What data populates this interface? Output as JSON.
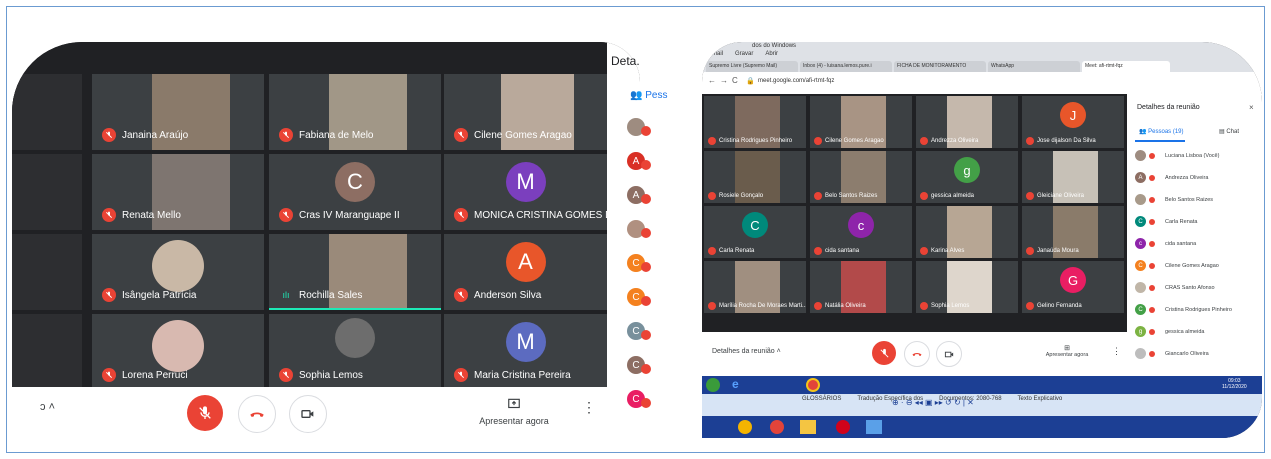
{
  "left": {
    "sidebar": {
      "title": "Deta.",
      "people_tab": "Pess"
    },
    "participants": [
      {
        "name": "Janaina Araújo",
        "type": "photo",
        "color": "#8a7a6a"
      },
      {
        "name": "Fabiana de Melo",
        "type": "photo",
        "color": "#a19787"
      },
      {
        "name": "Cilene Gomes Aragao",
        "type": "photo",
        "color": "#b9a99b"
      },
      {
        "name": "Renata Mello",
        "type": "photo",
        "color": "#7e7570"
      },
      {
        "name": "Cras IV Maranguape II",
        "type": "avatar",
        "initial": "C",
        "color": "#8d6e63"
      },
      {
        "name": "MONICA CRISTINA GOMES DE ...",
        "type": "avatar",
        "initial": "M",
        "color": "#7b3fbe"
      },
      {
        "name": "Isângela Patrícia",
        "type": "photo",
        "color": "#c9b8a6"
      },
      {
        "name": "Rochilla Sales",
        "type": "photo",
        "color": "#9a8a7a"
      },
      {
        "name": "Anderson Silva",
        "type": "avatar",
        "initial": "A",
        "color": "#e8562a"
      },
      {
        "name": "Lorena Perruci",
        "type": "photo",
        "color": "#d8b9b0"
      },
      {
        "name": "Sophia Lemos",
        "type": "photo",
        "color": "#6d6d6d"
      },
      {
        "name": "Maria Cristina Pereira",
        "type": "avatar",
        "initial": "M",
        "color": "#5c6bc0"
      }
    ],
    "side_avatars": [
      {
        "initial": "",
        "color": "#9e8c80"
      },
      {
        "initial": "A",
        "color": "#d93025"
      },
      {
        "initial": "A",
        "color": "#8d6e63"
      },
      {
        "initial": "",
        "color": "#b09080"
      },
      {
        "initial": "C",
        "color": "#f4811f"
      },
      {
        "initial": "C",
        "color": "#f4811f"
      },
      {
        "initial": "C",
        "color": "#78909c"
      },
      {
        "initial": "C",
        "color": "#8d6e63"
      },
      {
        "initial": "C",
        "color": "#e91e63"
      }
    ],
    "bottom": {
      "present_label": "Apresentar agora",
      "caret": "˄"
    }
  },
  "right": {
    "tabs": [
      "Supremo Livre (Supremo Mail)",
      "Inbox (4) - luisana.lemos.pure.i",
      "FICHA DE MONITORAMENTO",
      "WhatsApp",
      "Meet: afi-rtmt-fqz"
    ],
    "menu": [
      "Email",
      "Gravar",
      "Abrir"
    ],
    "window_title": "dos do Windows",
    "url": "meet.google.com/afi-rtmt-fqz",
    "participants": [
      {
        "name": "Cristina Rodrigues Pinheiro",
        "type": "photo",
        "color": "#7e6a5e"
      },
      {
        "name": "Cilene Gomes Aragao",
        "type": "photo",
        "color": "#a89484"
      },
      {
        "name": "Andrezza Oliveira",
        "type": "photo",
        "color": "#c5b8ac"
      },
      {
        "name": "Jose dijalson Da Silva",
        "type": "avatar",
        "initial": "J",
        "color": "#e8562a"
      },
      {
        "name": "Rosiele Gonçalo",
        "type": "photo",
        "color": "#6a5c4c"
      },
      {
        "name": "Belo Santos Raizes",
        "type": "photo",
        "color": "#8c7d6e"
      },
      {
        "name": "gessica almeida",
        "type": "avatar",
        "initial": "g",
        "color": "#43a047"
      },
      {
        "name": "Gleiciane Oliveira",
        "type": "photo",
        "color": "#c7c1b7"
      },
      {
        "name": "Carla Renata",
        "type": "avatar",
        "initial": "C",
        "color": "#00897b"
      },
      {
        "name": "cida santana",
        "type": "avatar",
        "initial": "c",
        "color": "#8e24aa"
      },
      {
        "name": "Karina Alves",
        "type": "photo",
        "color": "#b7a694"
      },
      {
        "name": "Janaúda Moura",
        "type": "photo",
        "color": "#8a7b6a"
      },
      {
        "name": "Marília Rocha De Moraes Marti...",
        "type": "photo",
        "color": "#a08f80"
      },
      {
        "name": "Natália Oliveira",
        "type": "photo",
        "color": "#b24a4a"
      },
      {
        "name": "Sophia Lemos",
        "type": "photo",
        "color": "#ded6cc"
      },
      {
        "name": "Gelino Fernanda",
        "type": "avatar",
        "initial": "G",
        "color": "#e91e63"
      }
    ],
    "panel": {
      "title": "Detalhes da reunião",
      "people_tab": "Pessoas (19)",
      "chat_tab": "Chat",
      "people": [
        {
          "name": "Luciana Lisboa (Você)",
          "initial": "",
          "color": "#9e8c80"
        },
        {
          "name": "Andrezza Oliveira",
          "initial": "A",
          "color": "#8d6e63"
        },
        {
          "name": "Belo Santos Raizes",
          "initial": "",
          "color": "#a89a8a"
        },
        {
          "name": "Carla Renata",
          "initial": "C",
          "color": "#00897b"
        },
        {
          "name": "cida santana",
          "initial": "c",
          "color": "#8e24aa"
        },
        {
          "name": "Cilene Gomes Aragao",
          "initial": "C",
          "color": "#f4811f"
        },
        {
          "name": "CRAS Santo Afonso",
          "initial": "",
          "color": "#c0b6a8"
        },
        {
          "name": "Cristina Rodrigues Pinheiro",
          "initial": "C",
          "color": "#43a047"
        },
        {
          "name": "gessica almeida",
          "initial": "g",
          "color": "#7cb342"
        },
        {
          "name": "Giancarlo Oliveira",
          "initial": "",
          "color": "#bdbdbd"
        }
      ]
    },
    "bottom": {
      "details": "Detalhes da reunião",
      "caret": "˄",
      "present_label": "Apresentar agora"
    },
    "tray_time": "09:03",
    "tray_date": "11/12/2020",
    "ribbon_text": [
      "GLOSSÁRIOS",
      "Tradução Específica dos",
      "Documentos: 2080-768",
      "Texto Explicativo"
    ]
  },
  "colors": {
    "mute_red": "#ea4335",
    "meet_dark": "#202124",
    "tile_gray": "#3c4043",
    "accent_blue": "#1a73e8",
    "speaking_green": "#1de9b6"
  }
}
